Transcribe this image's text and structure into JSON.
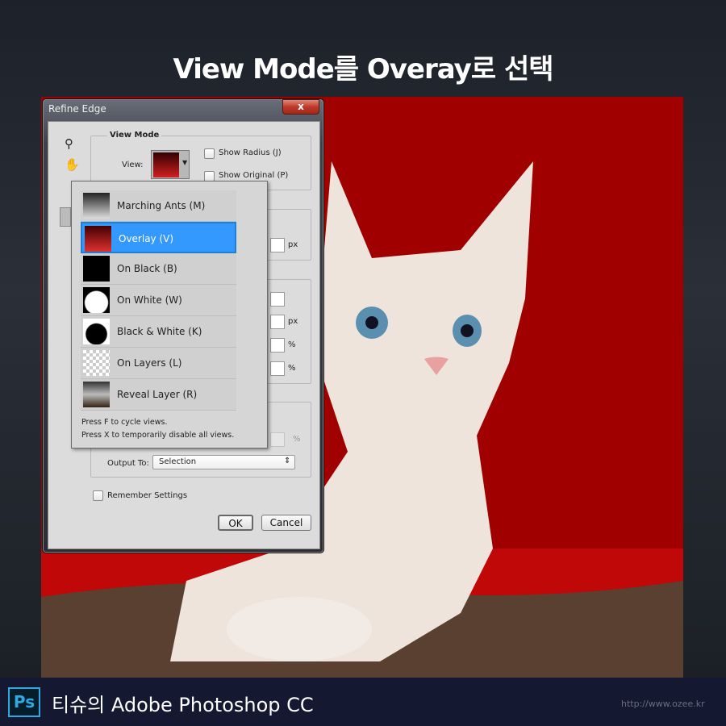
{
  "headline": "View Mode를 Overay로 선택",
  "dialog": {
    "title": "Refine Edge",
    "close_label": "x",
    "view_mode": {
      "legend": "View Mode",
      "view_label": "View:",
      "show_radius": "Show Radius (J)",
      "show_original": "Show Original (P)"
    },
    "units": {
      "px1": "px",
      "px2": "px",
      "pct1": "%",
      "pct2": "%",
      "pct3": "%"
    },
    "output_to_label": "Output To:",
    "output_to_value": "Selection",
    "remember_settings": "Remember Settings",
    "ok": "OK",
    "cancel": "Cancel"
  },
  "dropdown": {
    "items": [
      {
        "label": "Marching Ants (M)",
        "selected": false
      },
      {
        "label": "Overlay (V)",
        "selected": true
      },
      {
        "label": "On Black (B)",
        "selected": false
      },
      {
        "label": "On White (W)",
        "selected": false
      },
      {
        "label": "Black & White (K)",
        "selected": false
      },
      {
        "label": "On Layers (L)",
        "selected": false
      },
      {
        "label": "Reveal Layer (R)",
        "selected": false
      }
    ],
    "hint1": "Press F to cycle views.",
    "hint2": "Press X to temporarily disable all views."
  },
  "footer": {
    "logo": "Ps",
    "title": "티슈의 Adobe Photoshop CC",
    "url": "http://www.ozee.kr"
  },
  "colors": {
    "selection": "#3399ff",
    "backdrop": "#a00000",
    "footer": "#141830"
  }
}
